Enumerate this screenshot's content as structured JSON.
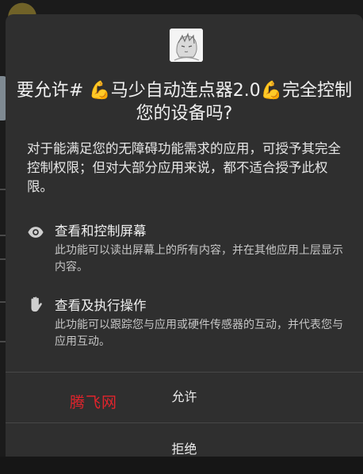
{
  "dialog": {
    "app_icon": "app-avatar-icon",
    "title": "要允许# 💪马少自动连点器2.0💪完全控制您的设备吗?",
    "description": "对于能满足您的无障碍功能需求的应用，可授予其完全控制权限；但对大部分应用来说，都不适合授予此权限。",
    "permissions": [
      {
        "icon": "eye-icon",
        "title": "查看和控制屏幕",
        "description": "此功能可以读出屏幕上的所有内容，并在其他应用上层显示内容。"
      },
      {
        "icon": "hand-icon",
        "title": "查看及执行操作",
        "description": "此功能可以跟踪您与应用或硬件传感器的互动，并代表您与应用互动。"
      }
    ],
    "allow_label": "允许",
    "deny_label": "拒绝"
  },
  "watermark": "腾飞网",
  "colors": {
    "dialog_bg": "#2f2f2f",
    "page_bg": "#1b1b1b",
    "text_primary": "#f0f0f0",
    "text_secondary": "#c6c6c6",
    "divider": "#474747",
    "watermark": "#e0242c"
  }
}
